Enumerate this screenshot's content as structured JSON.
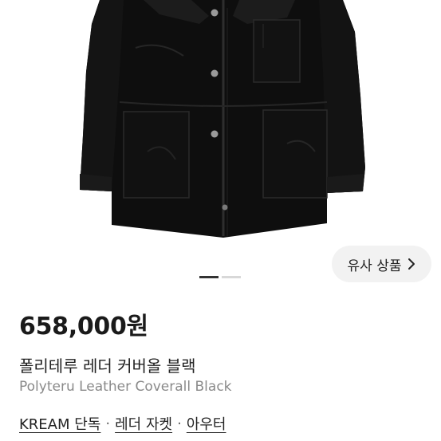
{
  "product": {
    "price": "658,000원",
    "name_ko": "폴리테루 레더 커버올 블랙",
    "name_en": "Polyteru Leather Coverall Black"
  },
  "similar_button": {
    "label": "유사 상품",
    "icon": "chevron-right-icon"
  },
  "image_carousel": {
    "total": 2,
    "active_index": 0
  },
  "categories": [
    {
      "label": "KREAM 단독"
    },
    {
      "label": "레더 자켓"
    },
    {
      "label": "아우터"
    }
  ],
  "category_separator": "·",
  "colors": {
    "jacket": "#0e0e0e",
    "button_bg": "#f2f2f2",
    "indicator_active": "#333333",
    "indicator_inactive": "#d8d8d8"
  }
}
